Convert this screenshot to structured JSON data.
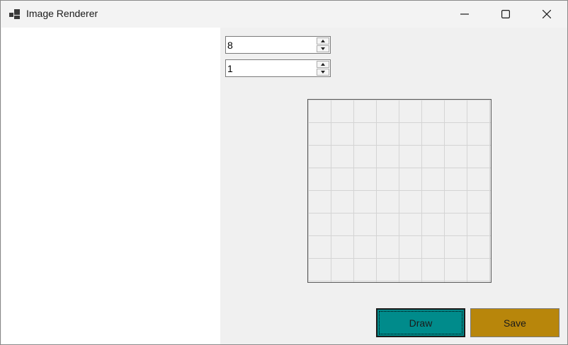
{
  "window": {
    "title": "Image Renderer",
    "app_icon": "renderer-app-icon",
    "controls": {
      "minimize": "minimize-icon",
      "maximize": "maximize-icon",
      "close": "close-icon"
    }
  },
  "inputs": {
    "grid_size": {
      "value": "8"
    },
    "pixel_scale": {
      "value": "1"
    }
  },
  "canvas": {
    "rows": 8,
    "cols": 8,
    "icon": "pixel-grid"
  },
  "buttons": {
    "draw_label": "Draw",
    "save_label": "Save"
  },
  "colors": {
    "draw_button": "#008b8b",
    "save_button": "#b8860b",
    "window_bg": "#f0f0f0",
    "left_panel_bg": "#ffffff",
    "grid_line": "#d4d4d4"
  }
}
